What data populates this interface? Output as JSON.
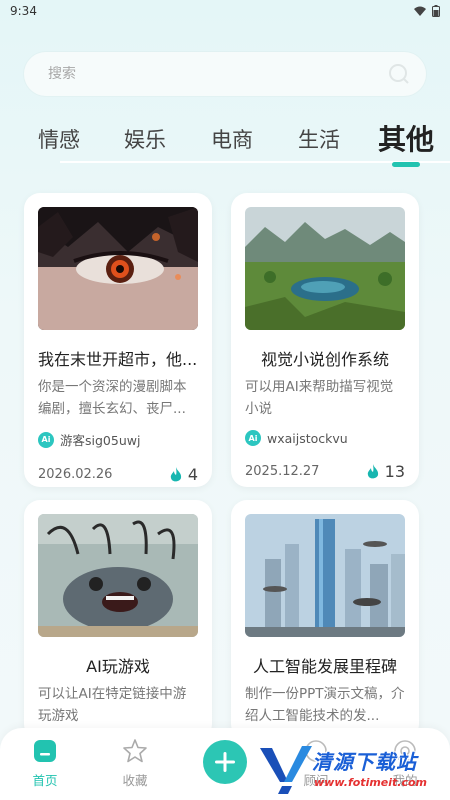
{
  "status": {
    "time": "9:34"
  },
  "search": {
    "placeholder": "搜索"
  },
  "tabs": [
    {
      "label": "情感"
    },
    {
      "label": "娱乐"
    },
    {
      "label": "电商"
    },
    {
      "label": "生活"
    },
    {
      "label": "其他",
      "active": true
    }
  ],
  "cards": [
    {
      "title": "我在末世开超市，他...",
      "description": "你是一个资深的漫剧脚本编剧，擅长玄幻、丧尸...",
      "author": "游客sig05uwj",
      "date": "2026.02.26",
      "heat": "4",
      "image": "anime-eye-image"
    },
    {
      "title": "视觉小说创作系统",
      "description": "可以用AI来帮助描写视觉小说",
      "author": "wxaijstockvu",
      "date": "2025.12.27",
      "heat": "13",
      "image": "landscape-lake-image"
    },
    {
      "title": "AI玩游戏",
      "description": "可以让AI在特定链接中游玩游戏",
      "image": "screaming-creature-image"
    },
    {
      "title": "人工智能发展里程碑",
      "description": "制作一份PPT演示文稿，介绍人工智能技术的发...",
      "image": "futuristic-city-image"
    }
  ],
  "ai_badge": "Ai",
  "bottom_nav": {
    "home": "首页",
    "favorites": "收藏",
    "partial_label": "顾问",
    "mine": "我的"
  },
  "watermark": {
    "name": "清源下载站",
    "url": "www.fotimeit.com"
  },
  "colors": {
    "accent": "#22c3b0",
    "heat_icon": "#17b6b0"
  }
}
